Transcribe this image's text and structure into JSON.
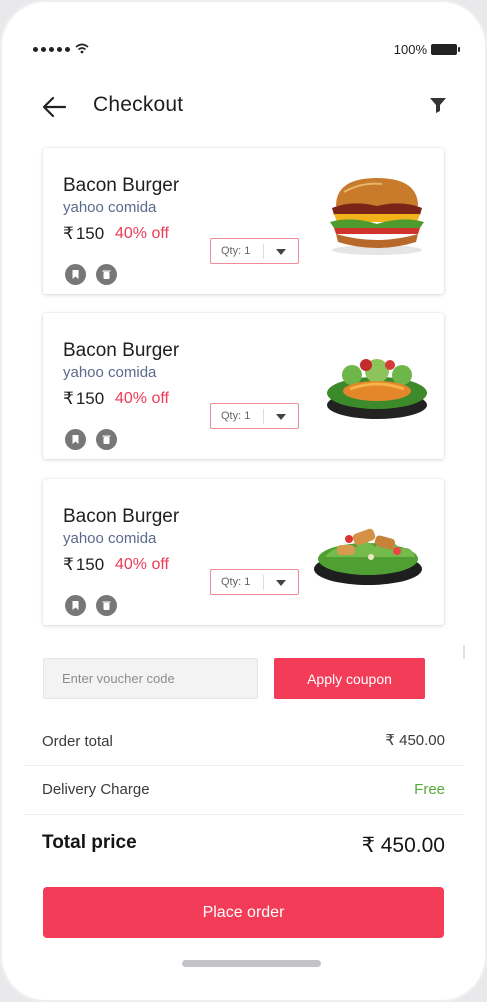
{
  "status_bar": {
    "battery": "100%"
  },
  "header": {
    "title": "Checkout",
    "back_icon": "arrow-left-icon",
    "filter_icon": "filter-icon"
  },
  "cart": {
    "items": [
      {
        "name": "Bacon Burger",
        "restaurant": "yahoo comida",
        "currency": "₹",
        "price": "150",
        "discount": "40% off",
        "qty_label": "Qty: 1",
        "image": "burger"
      },
      {
        "name": "Bacon Burger",
        "restaurant": "yahoo comida",
        "currency": "₹",
        "price": "150",
        "discount": "40% off",
        "qty_label": "Qty: 1",
        "image": "salad-bowl"
      },
      {
        "name": "Bacon Burger",
        "restaurant": "yahoo comida",
        "currency": "₹",
        "price": "150",
        "discount": "40% off",
        "qty_label": "Qty: 1",
        "image": "chicken-salad"
      }
    ]
  },
  "voucher": {
    "placeholder": "Enter voucher code",
    "apply_label": "Apply coupon"
  },
  "summary": {
    "order_total_label": "Order total",
    "order_total_value": "₹ 450.00",
    "delivery_label": "Delivery Charge",
    "delivery_value": "Free",
    "total_label": "Total price",
    "total_value": "₹ 450.00"
  },
  "place_order_label": "Place order",
  "colors": {
    "accent": "#f23c58",
    "discount": "#ee3b55",
    "free": "#55aa3a",
    "restaurant": "#5a6a8c"
  }
}
